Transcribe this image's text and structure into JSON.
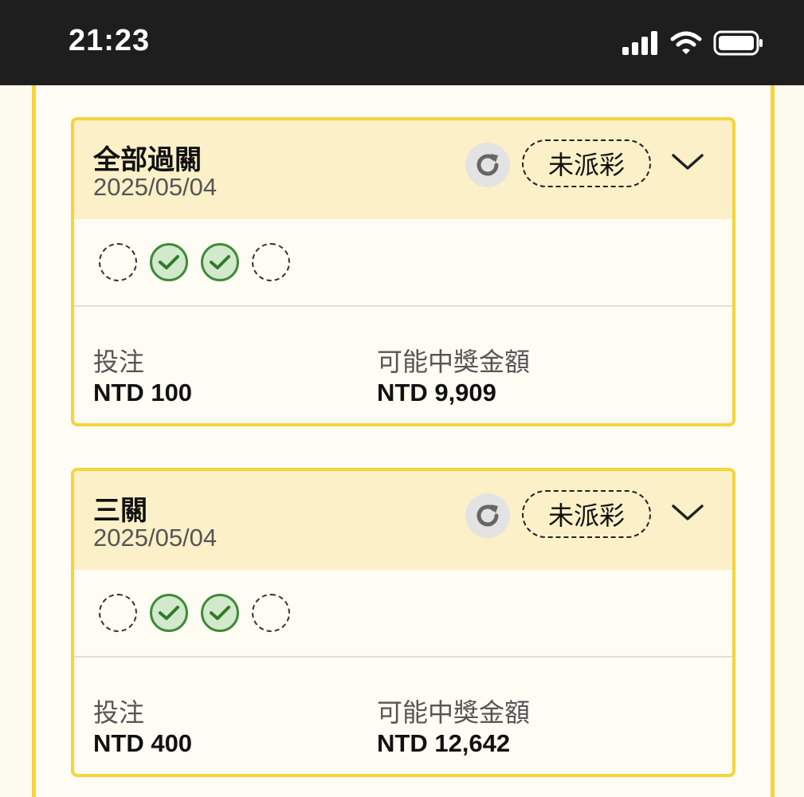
{
  "status_bar": {
    "time": "21:23"
  },
  "bets": [
    {
      "title": "全部過關",
      "date": "2025/05/04",
      "status": "未派彩",
      "legs": [
        "pending",
        "won",
        "won",
        "pending"
      ],
      "stake_label": "投注",
      "stake_value": "NTD 100",
      "payout_label": "可能中獎金額",
      "payout_value": "NTD 9,909"
    },
    {
      "title": "三關",
      "date": "2025/05/04",
      "status": "未派彩",
      "legs": [
        "pending",
        "won",
        "won",
        "pending"
      ],
      "stake_label": "投注",
      "stake_value": "NTD 400",
      "payout_label": "可能中獎金額",
      "payout_value": "NTD 12,642"
    }
  ],
  "icons": {
    "refresh": "refresh-icon",
    "chevron": "chevron-down-icon",
    "check": "check-icon",
    "signal": "signal-icon",
    "wifi": "wifi-icon",
    "battery": "battery-icon"
  },
  "colors": {
    "accent_yellow": "#f6d43a",
    "header_bg": "#fbf0c8",
    "won_green": "#3f8a3a",
    "won_fill": "#d2e9cc"
  }
}
